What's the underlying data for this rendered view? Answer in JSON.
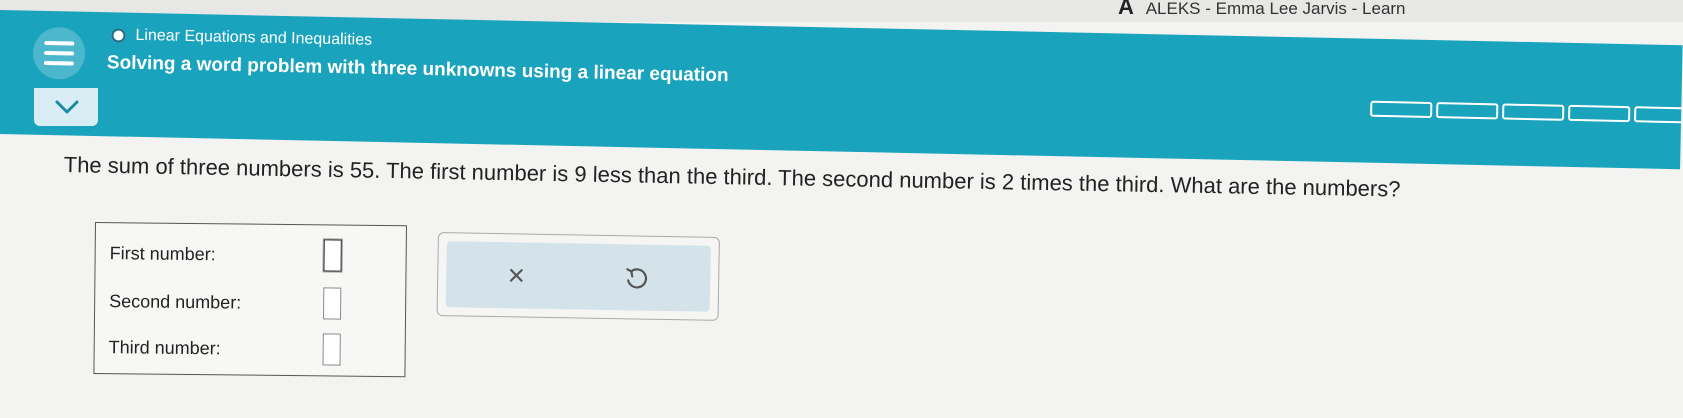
{
  "window": {
    "title": "ALEKS - Emma Lee Jarvis - Learn",
    "logo": "A"
  },
  "header": {
    "breadcrumb": "Linear Equations and Inequalities",
    "topic_title": "Solving a word problem with three unknowns using a linear equation",
    "menu_icon": "hamburger-icon",
    "progress_segments": 5
  },
  "question": {
    "text": "The sum of three numbers is 55. The first number is 9 less than the third. The second number is 2 times the third. What are the numbers?"
  },
  "answer": {
    "rows": [
      {
        "label": "First number:",
        "value": ""
      },
      {
        "label": "Second number:",
        "value": ""
      },
      {
        "label": "Third number:",
        "value": ""
      }
    ]
  },
  "actions": {
    "clear_symbol": "×",
    "undo_icon": "undo-icon"
  },
  "colors": {
    "banner": "#1aa3bd",
    "background": "#f3f3f1"
  }
}
